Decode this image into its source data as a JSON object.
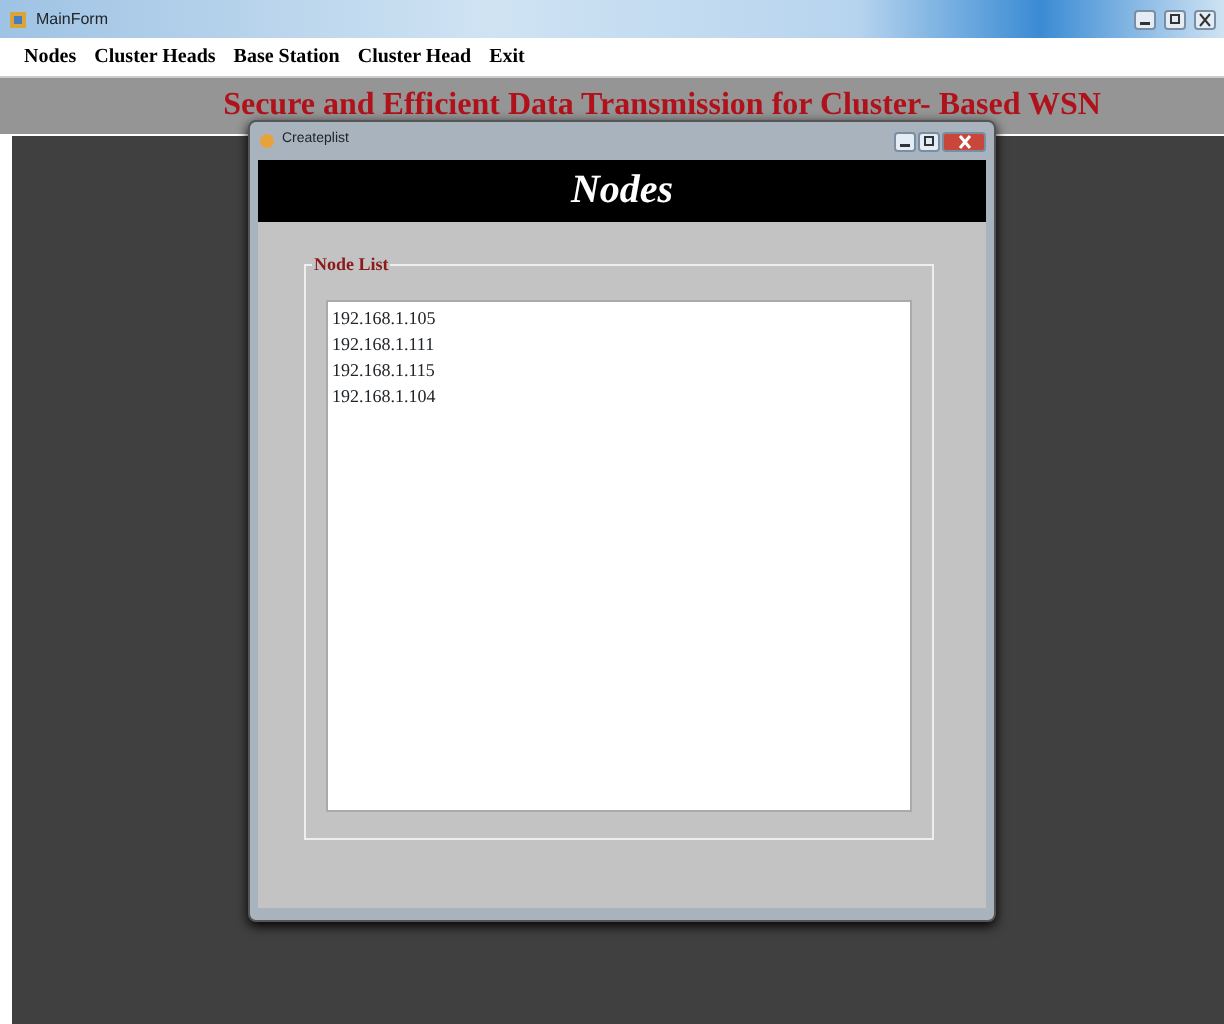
{
  "window": {
    "title": "MainForm"
  },
  "menu": [
    "Nodes",
    "Cluster Heads",
    "Base Station",
    "Cluster Head",
    "Exit"
  ],
  "heading": "Secure and Efficient Data Transmission for Cluster- Based WSN",
  "dialog": {
    "title": "Createplist",
    "header": "Nodes",
    "group_label": "Node List",
    "items": [
      "192.168.1.105",
      "192.168.1.111",
      "192.168.1.115",
      "192.168.1.104"
    ]
  }
}
